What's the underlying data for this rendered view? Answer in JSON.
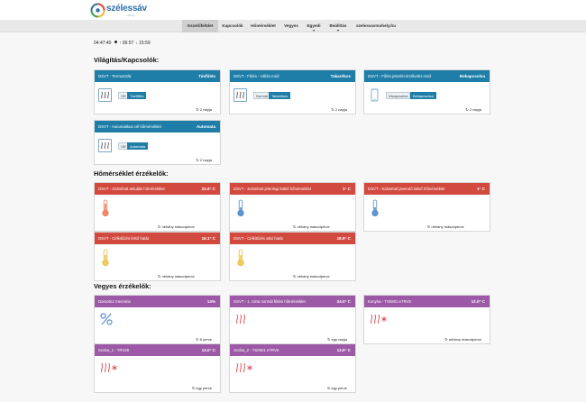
{
  "brand": {
    "name": "szélessáv",
    "tagline": "műhely"
  },
  "nav": [
    {
      "label": "Kezelőfelület",
      "active": true
    },
    {
      "label": "Kapcsolók"
    },
    {
      "label": "Hőmérséklet"
    },
    {
      "label": "Vegyes"
    },
    {
      "label": "Egyedi",
      "dropdown": true
    },
    {
      "label": "Beállítás",
      "dropdown": true
    },
    {
      "label": "szelessavmuhely.hu"
    }
  ],
  "time": {
    "clock": "04:47:40",
    "sunrise": "06:57",
    "sunset": "15:59"
  },
  "sections": {
    "switches": "Világítás/Kapcsolók:",
    "temps": "Hőmérséklet érzékelők:",
    "misc": "Vegyes érzékelők:"
  },
  "switch_cards": [
    {
      "title": "DSVT - Termosztát",
      "value": "Távfűtés",
      "buttons": [
        "Off",
        "Távfűtés"
      ],
      "active": 1,
      "updated": "2 napja",
      "icon": "heat-icon"
    },
    {
      "title": "DSVT - Fűtés - Hűtés mód",
      "value": "Takarékos",
      "buttons": [
        "Normál",
        "Takarékos"
      ],
      "active": 1,
      "updated": "2 napja",
      "icon": "heat-icon"
    },
    {
      "title": "DSVT - Fűtés jelenlét érzékelés mód",
      "value": "Bekapcsolva",
      "buttons": [
        "Kikapcsolva",
        "Bekapcsolva"
      ],
      "active": 1,
      "updated": "2 napja",
      "icon": "phone-icon"
    },
    {
      "title": "DSVT - Automatikus cél hőmérséklet",
      "value": "Automata",
      "buttons": [
        "Off",
        "Automata"
      ],
      "active": 1,
      "updated": "2 napja",
      "icon": "heat-icon"
    }
  ],
  "temp_cards": [
    {
      "title": "DSVT - Számított aktuális hőmérséklet",
      "value": "22.6° C",
      "updated": "néhány másodperce",
      "icon": "thermometer-hot-icon"
    },
    {
      "title": "DSVT - Számított jelenlegi külső hőmérséklet",
      "value": "1° C",
      "updated": "néhány másodperce",
      "icon": "thermometer-cold-icon"
    },
    {
      "title": "DSVT - Számított jövendő külső hőmérséklet",
      "value": "1° C",
      "updated": "néhány másodperce",
      "icon": "thermometer-cold-icon"
    },
    {
      "title": "DSVT - Célkitűzés felső határ",
      "value": "19.1° C",
      "updated": "néhány másodperce",
      "icon": "thermometer-warm-icon"
    },
    {
      "title": "DSVT - Célkitűzés alsó határ",
      "value": "18.9° C",
      "updated": "néhány másodperce",
      "icon": "thermometer-warm-icon"
    }
  ],
  "misc_cards": [
    {
      "title": "Domoticz memória",
      "value": "14%",
      "updated": "8 perce",
      "icon": "percent-icon"
    },
    {
      "title": "DSVT - 1. zóna normál fűtési hőmérséklet",
      "value": "24.0° C",
      "updated": "egy napja",
      "icon": "heat-icon"
    },
    {
      "title": "Konyha - TS0601 eTRV5",
      "value": "12.0° C",
      "updated": "néhány másodperce",
      "icon": "heat-icon"
    },
    {
      "title": "Szoba_1 - TRV28",
      "value": "13.0° C",
      "updated": "egy perce",
      "icon": "heat-icon"
    },
    {
      "title": "Szoba_2 - TS0601 eTRV5",
      "value": "13.0° C",
      "updated": "egy perce",
      "icon": "heat-icon"
    }
  ],
  "colors": {
    "switch_header": "#1f7ea8",
    "temp_header": "#d24a3f",
    "misc_header": "#9c5aa6"
  }
}
